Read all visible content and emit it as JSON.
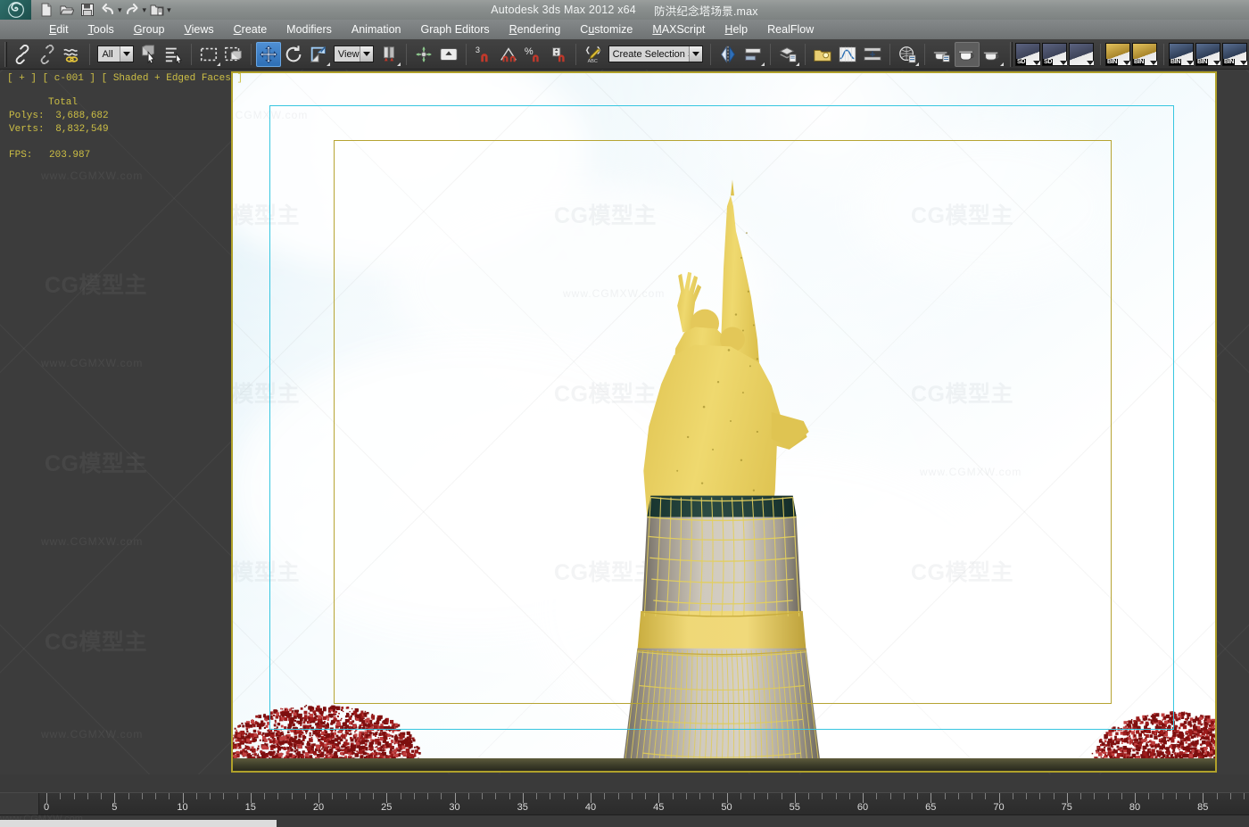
{
  "app": {
    "title": "Autodesk 3ds Max  2012 x64",
    "filename": "防洪纪念塔场景.max",
    "logo_icon": "max-logo-icon"
  },
  "quick_access": [
    {
      "name": "new-file-button",
      "icon": "new-file-icon"
    },
    {
      "name": "open-file-button",
      "icon": "open-folder-icon"
    },
    {
      "name": "save-file-button",
      "icon": "floppy-save-icon"
    },
    {
      "name": "undo-button",
      "icon": "undo-arrow-icon"
    },
    {
      "name": "undo-dropdown",
      "icon": "dropdown-dot-icon"
    },
    {
      "name": "redo-button",
      "icon": "redo-arrow-icon"
    },
    {
      "name": "redo-dropdown",
      "icon": "dropdown-dot-icon"
    },
    {
      "name": "project-folder-button",
      "icon": "project-folder-icon"
    },
    {
      "name": "qat-customize-button",
      "icon": "chevron-down-icon"
    }
  ],
  "menubar": [
    {
      "label": "Edit",
      "accel": "E"
    },
    {
      "label": "Tools",
      "accel": "T"
    },
    {
      "label": "Group",
      "accel": "G"
    },
    {
      "label": "Views",
      "accel": "V"
    },
    {
      "label": "Create",
      "accel": "C"
    },
    {
      "label": "Modifiers",
      "accel": ""
    },
    {
      "label": "Animation",
      "accel": ""
    },
    {
      "label": "Graph Editors",
      "accel": ""
    },
    {
      "label": "Rendering",
      "accel": "R"
    },
    {
      "label": "Customize",
      "accel": "u"
    },
    {
      "label": "MAXScript",
      "accel": "M"
    },
    {
      "label": "Help",
      "accel": "H"
    },
    {
      "label": "RealFlow",
      "accel": ""
    }
  ],
  "toolbar": {
    "select_filter_value": "All",
    "reference_coord_value": "View",
    "selection_set_value": "Create Selection Se",
    "buttons": [
      {
        "name": "select-and-link-button",
        "icon": "link-chain-icon"
      },
      {
        "name": "unlink-selection-button",
        "icon": "broken-chain-icon"
      },
      {
        "name": "bind-to-space-warp-button",
        "icon": "space-warp-icon"
      },
      {
        "name": "select-object-button",
        "icon": "arrow-cursor-icon"
      },
      {
        "name": "select-by-name-button",
        "icon": "select-by-name-icon"
      },
      {
        "name": "rectangular-selection-region-button",
        "icon": "rectangle-marquee-icon"
      },
      {
        "name": "window-crossing-toggle-button",
        "icon": "window-crossing-icon"
      },
      {
        "name": "select-and-move-button",
        "icon": "move-gizmo-icon"
      },
      {
        "name": "select-and-rotate-button",
        "icon": "rotate-gizmo-icon"
      },
      {
        "name": "select-and-scale-button",
        "icon": "scale-gizmo-icon"
      },
      {
        "name": "use-center-flyout-button",
        "icon": "pivot-center-icon"
      },
      {
        "name": "select-and-manipulate-button",
        "icon": "manipulate-icon"
      },
      {
        "name": "snap-toggle-button",
        "icon": "snap-3-magnet-icon"
      },
      {
        "name": "angle-snap-toggle-button",
        "icon": "angle-snap-icon"
      },
      {
        "name": "percent-snap-toggle-button",
        "icon": "percent-snap-icon"
      },
      {
        "name": "spinner-snap-toggle-button",
        "icon": "spinner-snap-icon"
      },
      {
        "name": "edit-named-selection-sets-button",
        "icon": "named-selection-icon"
      },
      {
        "name": "mirror-button",
        "icon": "mirror-icon"
      },
      {
        "name": "align-flyout-button",
        "icon": "align-icon"
      },
      {
        "name": "layer-manager-button",
        "icon": "layers-icon"
      },
      {
        "name": "toggle-scene-explorer-button",
        "icon": "scene-explorer-icon"
      },
      {
        "name": "curve-editor-button",
        "icon": "curve-editor-icon"
      },
      {
        "name": "schematic-view-button",
        "icon": "schematic-view-icon"
      },
      {
        "name": "material-editor-button",
        "icon": "material-editor-icon"
      },
      {
        "name": "render-setup-button",
        "icon": "teapot-render-setup-icon"
      },
      {
        "name": "rendered-frame-window-button",
        "icon": "teapot-frame-window-icon"
      },
      {
        "name": "render-production-button",
        "icon": "teapot-render-icon"
      }
    ],
    "presets": [
      {
        "name": "preset-sd-box-1",
        "label": "SD",
        "icon": "box-preset-icon"
      },
      {
        "name": "preset-sd-box-2",
        "label": "SD",
        "icon": "box-preset-icon"
      },
      {
        "name": "preset-box-plain",
        "label": "",
        "icon": "box-preset-icon"
      },
      {
        "name": "preset-bin-gold-1",
        "label": "BIN",
        "icon": "gold-preset-icon"
      },
      {
        "name": "preset-bin-gold-2",
        "label": "BIN",
        "icon": "gold-preset-icon"
      },
      {
        "name": "preset-bin-blue-1",
        "label": "BIN",
        "icon": "blue-preset-icon"
      },
      {
        "name": "preset-bin-blue-2",
        "label": "BIN",
        "icon": "blue-preset-icon"
      },
      {
        "name": "preset-bin-blue-3",
        "label": "BIN",
        "icon": "blue-preset-icon"
      }
    ]
  },
  "viewport": {
    "label": "[ + ] [ c-001 ] [ Shaded + Edged Faces ]",
    "stats": {
      "header": "Total",
      "polys_label": "Polys:",
      "polys_value": "3,688,682",
      "verts_label": "Verts:",
      "verts_value": "8,832,549",
      "fps_label": "FPS:",
      "fps_value": "203.987"
    },
    "stats_color": "#d4c84a",
    "active_border_color": "#b0a12a",
    "safe_frame_outer_color": "#37c6e0",
    "safe_frame_inner_color": "#b6a432",
    "scene_objects": [
      {
        "name": "flood-control-monument-statue",
        "color": "#e6cc5e"
      },
      {
        "name": "monument-tower-cylinder",
        "color": "#c9c2b4"
      },
      {
        "name": "tree-foliage-left",
        "color": "#8e1414"
      },
      {
        "name": "tree-foliage-right",
        "color": "#8e1414"
      },
      {
        "name": "ground-plane",
        "color": "#5d5b3c"
      }
    ]
  },
  "watermark": {
    "logo_text": "CG模型主",
    "url_text": "www.CGMXW.com"
  },
  "timeline": {
    "start": 0,
    "end": 88,
    "label_step": 5,
    "minor_step": 1,
    "labels": [
      0,
      5,
      10,
      15,
      20,
      25,
      30,
      35,
      40,
      45,
      50,
      55,
      60,
      65,
      70,
      75,
      80,
      85
    ],
    "track_bar_button": "open-mini-curve-editor-button"
  }
}
